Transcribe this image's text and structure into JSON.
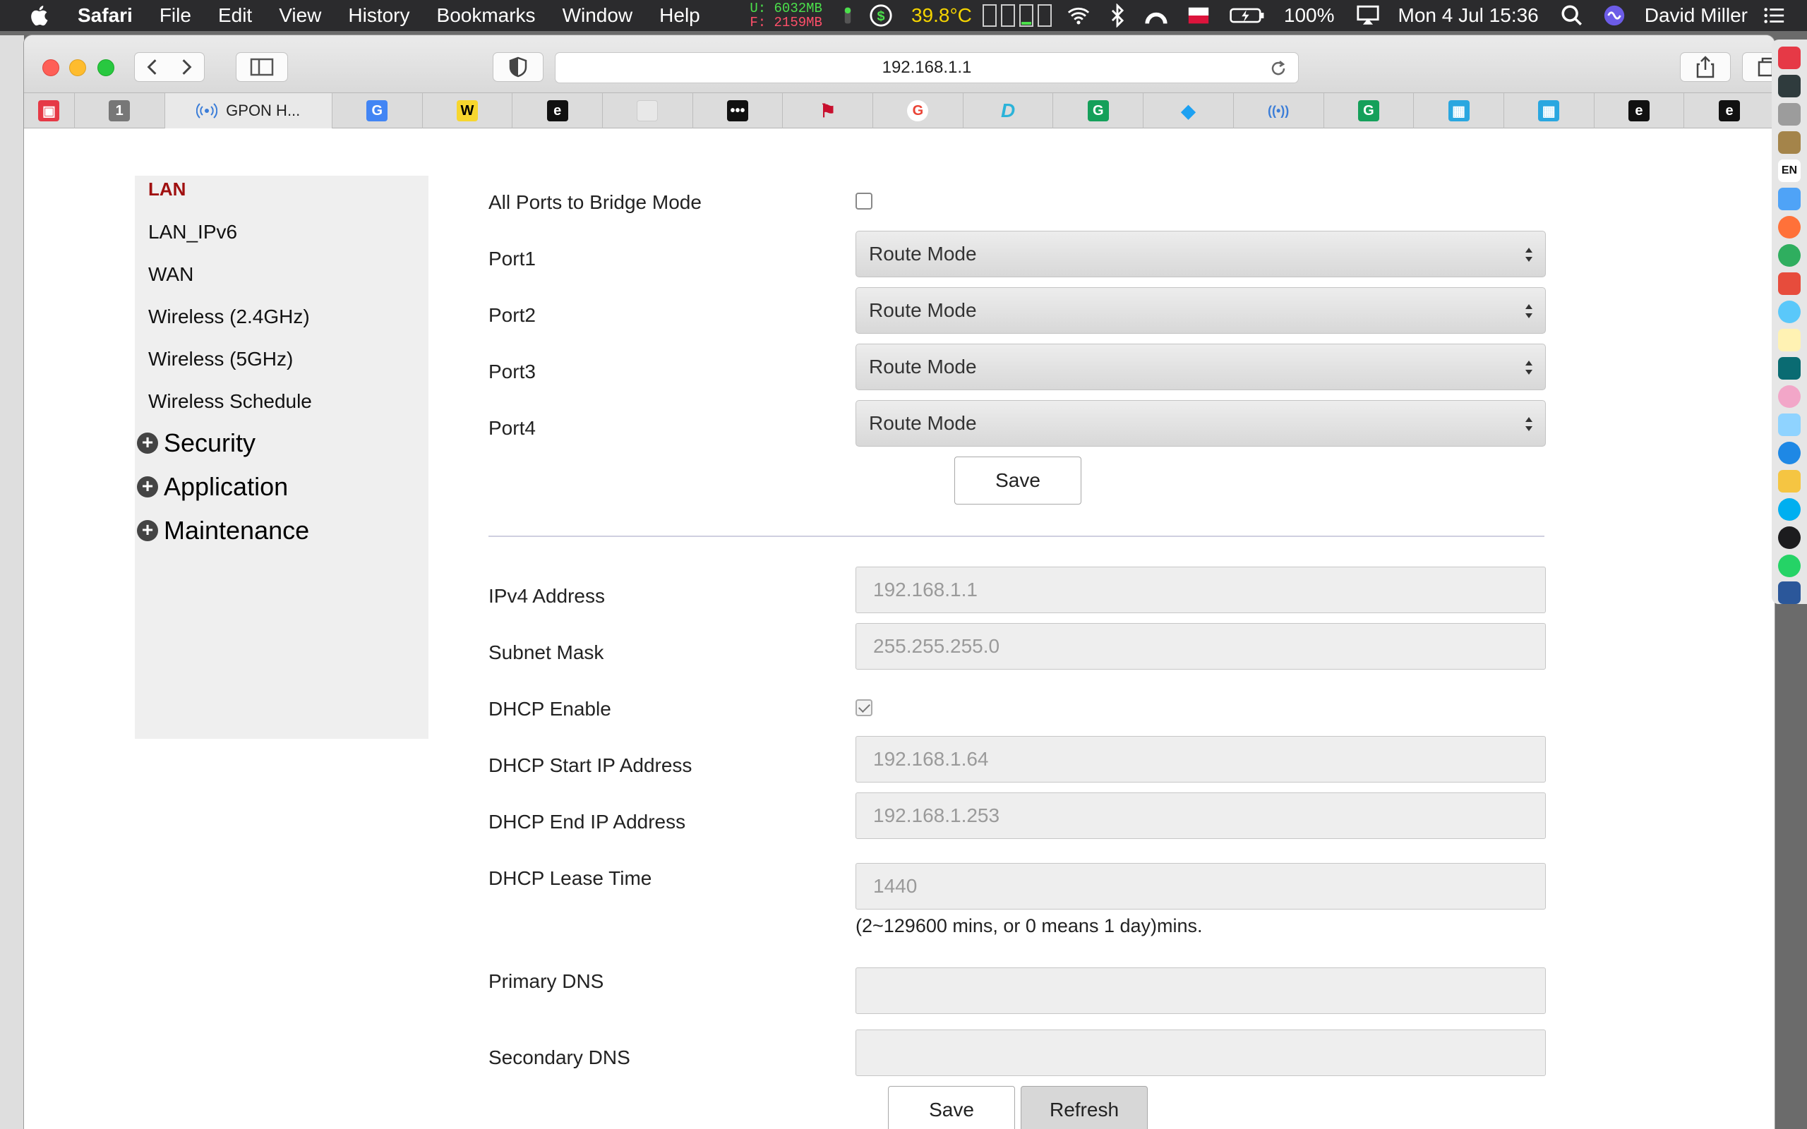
{
  "menubar": {
    "app_name": "Safari",
    "items": [
      "File",
      "Edit",
      "View",
      "History",
      "Bookmarks",
      "Window",
      "Help"
    ],
    "memory_used": "U: 6032MB",
    "memory_free": "F: 2159MB",
    "temperature": "39.8°C",
    "battery": "100%",
    "datetime": "Mon 4 Jul  15:36",
    "user": "David Miller"
  },
  "browser": {
    "url": "192.168.1.1",
    "active_tab_label": "GPON H...",
    "pinned_badge": "1"
  },
  "sidebar": {
    "active_item": "LAN",
    "items": [
      "LAN_IPv6",
      "WAN",
      "Wireless (2.4GHz)",
      "Wireless (5GHz)",
      "Wireless Schedule"
    ],
    "groups": [
      "Security",
      "Application",
      "Maintenance"
    ]
  },
  "ports_form": {
    "bridge_label": "All Ports to Bridge Mode",
    "bridge_checked": false,
    "ports": [
      {
        "label": "Port1",
        "value": "Route Mode"
      },
      {
        "label": "Port2",
        "value": "Route Mode"
      },
      {
        "label": "Port3",
        "value": "Route Mode"
      },
      {
        "label": "Port4",
        "value": "Route Mode"
      }
    ],
    "save_label": "Save"
  },
  "lan_form": {
    "ipv4_label": "IPv4 Address",
    "ipv4_value": "192.168.1.1",
    "subnet_label": "Subnet Mask",
    "subnet_value": "255.255.255.0",
    "dhcp_label": "DHCP Enable",
    "dhcp_checked": true,
    "dhcp_start_label": "DHCP Start IP Address",
    "dhcp_start_value": "192.168.1.64",
    "dhcp_end_label": "DHCP End IP Address",
    "dhcp_end_value": "192.168.1.253",
    "lease_label": "DHCP Lease Time",
    "lease_value": "1440",
    "lease_hint": "(2~129600 mins, or 0 means 1 day)mins.",
    "primary_dns_label": "Primary DNS",
    "primary_dns_value": "",
    "secondary_dns_label": "Secondary DNS",
    "secondary_dns_value": "",
    "save_label": "Save",
    "refresh_label": "Refresh"
  },
  "dock": {
    "language_badge": "EN"
  },
  "colors": {
    "menubar_bg": "#2b2b2d",
    "active_nav": "#a01010",
    "sidebar_bg": "#efefef",
    "input_bg": "#eeeeee"
  }
}
